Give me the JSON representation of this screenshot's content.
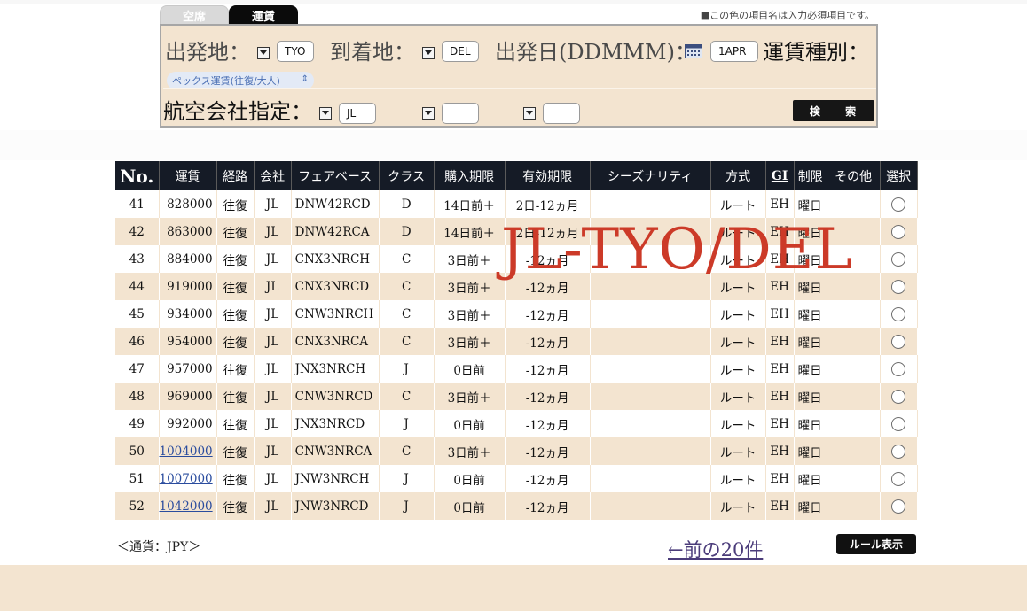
{
  "tabs": {
    "seat": "空席",
    "fare": "運賃"
  },
  "required_note": "■この色の項目名は入力必須項目です。",
  "search": {
    "departure_label": "出発地：",
    "departure_value": "TYO",
    "arrival_label": "到着地：",
    "arrival_value": "DEL",
    "date_label": "出発日(DDMMM)：",
    "date_value": "1APR",
    "fare_type_label": "運賃種別：",
    "fare_type_value": "ペックス運賃(往復/大人)",
    "airline_label": "航空会社指定：",
    "airline_values": [
      "JL",
      "",
      ""
    ],
    "search_button": "検 索"
  },
  "table": {
    "headers": [
      "No.",
      "運賃",
      "経路",
      "会社",
      "フェアベース",
      "クラス",
      "購入期限",
      "有効期限",
      "シーズナリティ",
      "方式",
      "GI",
      "制限",
      "その他",
      "選択"
    ],
    "rows": [
      {
        "no": "41",
        "fare": "828000",
        "route": "往復",
        "airline": "JL",
        "basis": "DNW42RCD",
        "cls": "D",
        "purchase": "14日前＋",
        "validity": "2日-12ヵ月",
        "season": "",
        "method": "ルート",
        "gi": "EH",
        "restrict": "曜日",
        "other": "",
        "link": false
      },
      {
        "no": "42",
        "fare": "863000",
        "route": "往復",
        "airline": "JL",
        "basis": "DNW42RCA",
        "cls": "D",
        "purchase": "14日前＋",
        "validity": "2日-12ヵ月",
        "season": "",
        "method": "ルート",
        "gi": "EH",
        "restrict": "曜日",
        "other": "",
        "link": false
      },
      {
        "no": "43",
        "fare": "884000",
        "route": "往復",
        "airline": "JL",
        "basis": "CNX3NRCH",
        "cls": "C",
        "purchase": "3日前＋",
        "validity": "-12ヵ月",
        "season": "",
        "method": "ルート",
        "gi": "EH",
        "restrict": "曜日",
        "other": "",
        "link": false
      },
      {
        "no": "44",
        "fare": "919000",
        "route": "往復",
        "airline": "JL",
        "basis": "CNX3NRCD",
        "cls": "C",
        "purchase": "3日前＋",
        "validity": "-12ヵ月",
        "season": "",
        "method": "ルート",
        "gi": "EH",
        "restrict": "曜日",
        "other": "",
        "link": false
      },
      {
        "no": "45",
        "fare": "934000",
        "route": "往復",
        "airline": "JL",
        "basis": "CNW3NRCH",
        "cls": "C",
        "purchase": "3日前＋",
        "validity": "-12ヵ月",
        "season": "",
        "method": "ルート",
        "gi": "EH",
        "restrict": "曜日",
        "other": "",
        "link": false
      },
      {
        "no": "46",
        "fare": "954000",
        "route": "往復",
        "airline": "JL",
        "basis": "CNX3NRCA",
        "cls": "C",
        "purchase": "3日前＋",
        "validity": "-12ヵ月",
        "season": "",
        "method": "ルート",
        "gi": "EH",
        "restrict": "曜日",
        "other": "",
        "link": false
      },
      {
        "no": "47",
        "fare": "957000",
        "route": "往復",
        "airline": "JL",
        "basis": "JNX3NRCH",
        "cls": "J",
        "purchase": "0日前",
        "validity": "-12ヵ月",
        "season": "",
        "method": "ルート",
        "gi": "EH",
        "restrict": "曜日",
        "other": "",
        "link": false
      },
      {
        "no": "48",
        "fare": "969000",
        "route": "往復",
        "airline": "JL",
        "basis": "CNW3NRCD",
        "cls": "C",
        "purchase": "3日前＋",
        "validity": "-12ヵ月",
        "season": "",
        "method": "ルート",
        "gi": "EH",
        "restrict": "曜日",
        "other": "",
        "link": false
      },
      {
        "no": "49",
        "fare": "992000",
        "route": "往復",
        "airline": "JL",
        "basis": "JNX3NRCD",
        "cls": "J",
        "purchase": "0日前",
        "validity": "-12ヵ月",
        "season": "",
        "method": "ルート",
        "gi": "EH",
        "restrict": "曜日",
        "other": "",
        "link": false
      },
      {
        "no": "50",
        "fare": "1004000",
        "route": "往復",
        "airline": "JL",
        "basis": "CNW3NRCA",
        "cls": "C",
        "purchase": "3日前＋",
        "validity": "-12ヵ月",
        "season": "",
        "method": "ルート",
        "gi": "EH",
        "restrict": "曜日",
        "other": "",
        "link": true
      },
      {
        "no": "51",
        "fare": "1007000",
        "route": "往復",
        "airline": "JL",
        "basis": "JNW3NRCH",
        "cls": "J",
        "purchase": "0日前",
        "validity": "-12ヵ月",
        "season": "",
        "method": "ルート",
        "gi": "EH",
        "restrict": "曜日",
        "other": "",
        "link": true
      },
      {
        "no": "52",
        "fare": "1042000",
        "route": "往復",
        "airline": "JL",
        "basis": "JNW3NRCD",
        "cls": "J",
        "purchase": "0日前",
        "validity": "-12ヵ月",
        "season": "",
        "method": "ルート",
        "gi": "EH",
        "restrict": "曜日",
        "other": "",
        "link": true
      }
    ]
  },
  "overlay_text": "JL-TYO/DEL",
  "currency_note": "＜通貨：JPY＞",
  "prev_link": "←前の20件",
  "rule_button": "ルール表示",
  "colors": {
    "panel_bg": "#f3e4d0",
    "header_bg": "#151b26",
    "overlay": "#cc3a28",
    "link": "#2a4c9e"
  }
}
